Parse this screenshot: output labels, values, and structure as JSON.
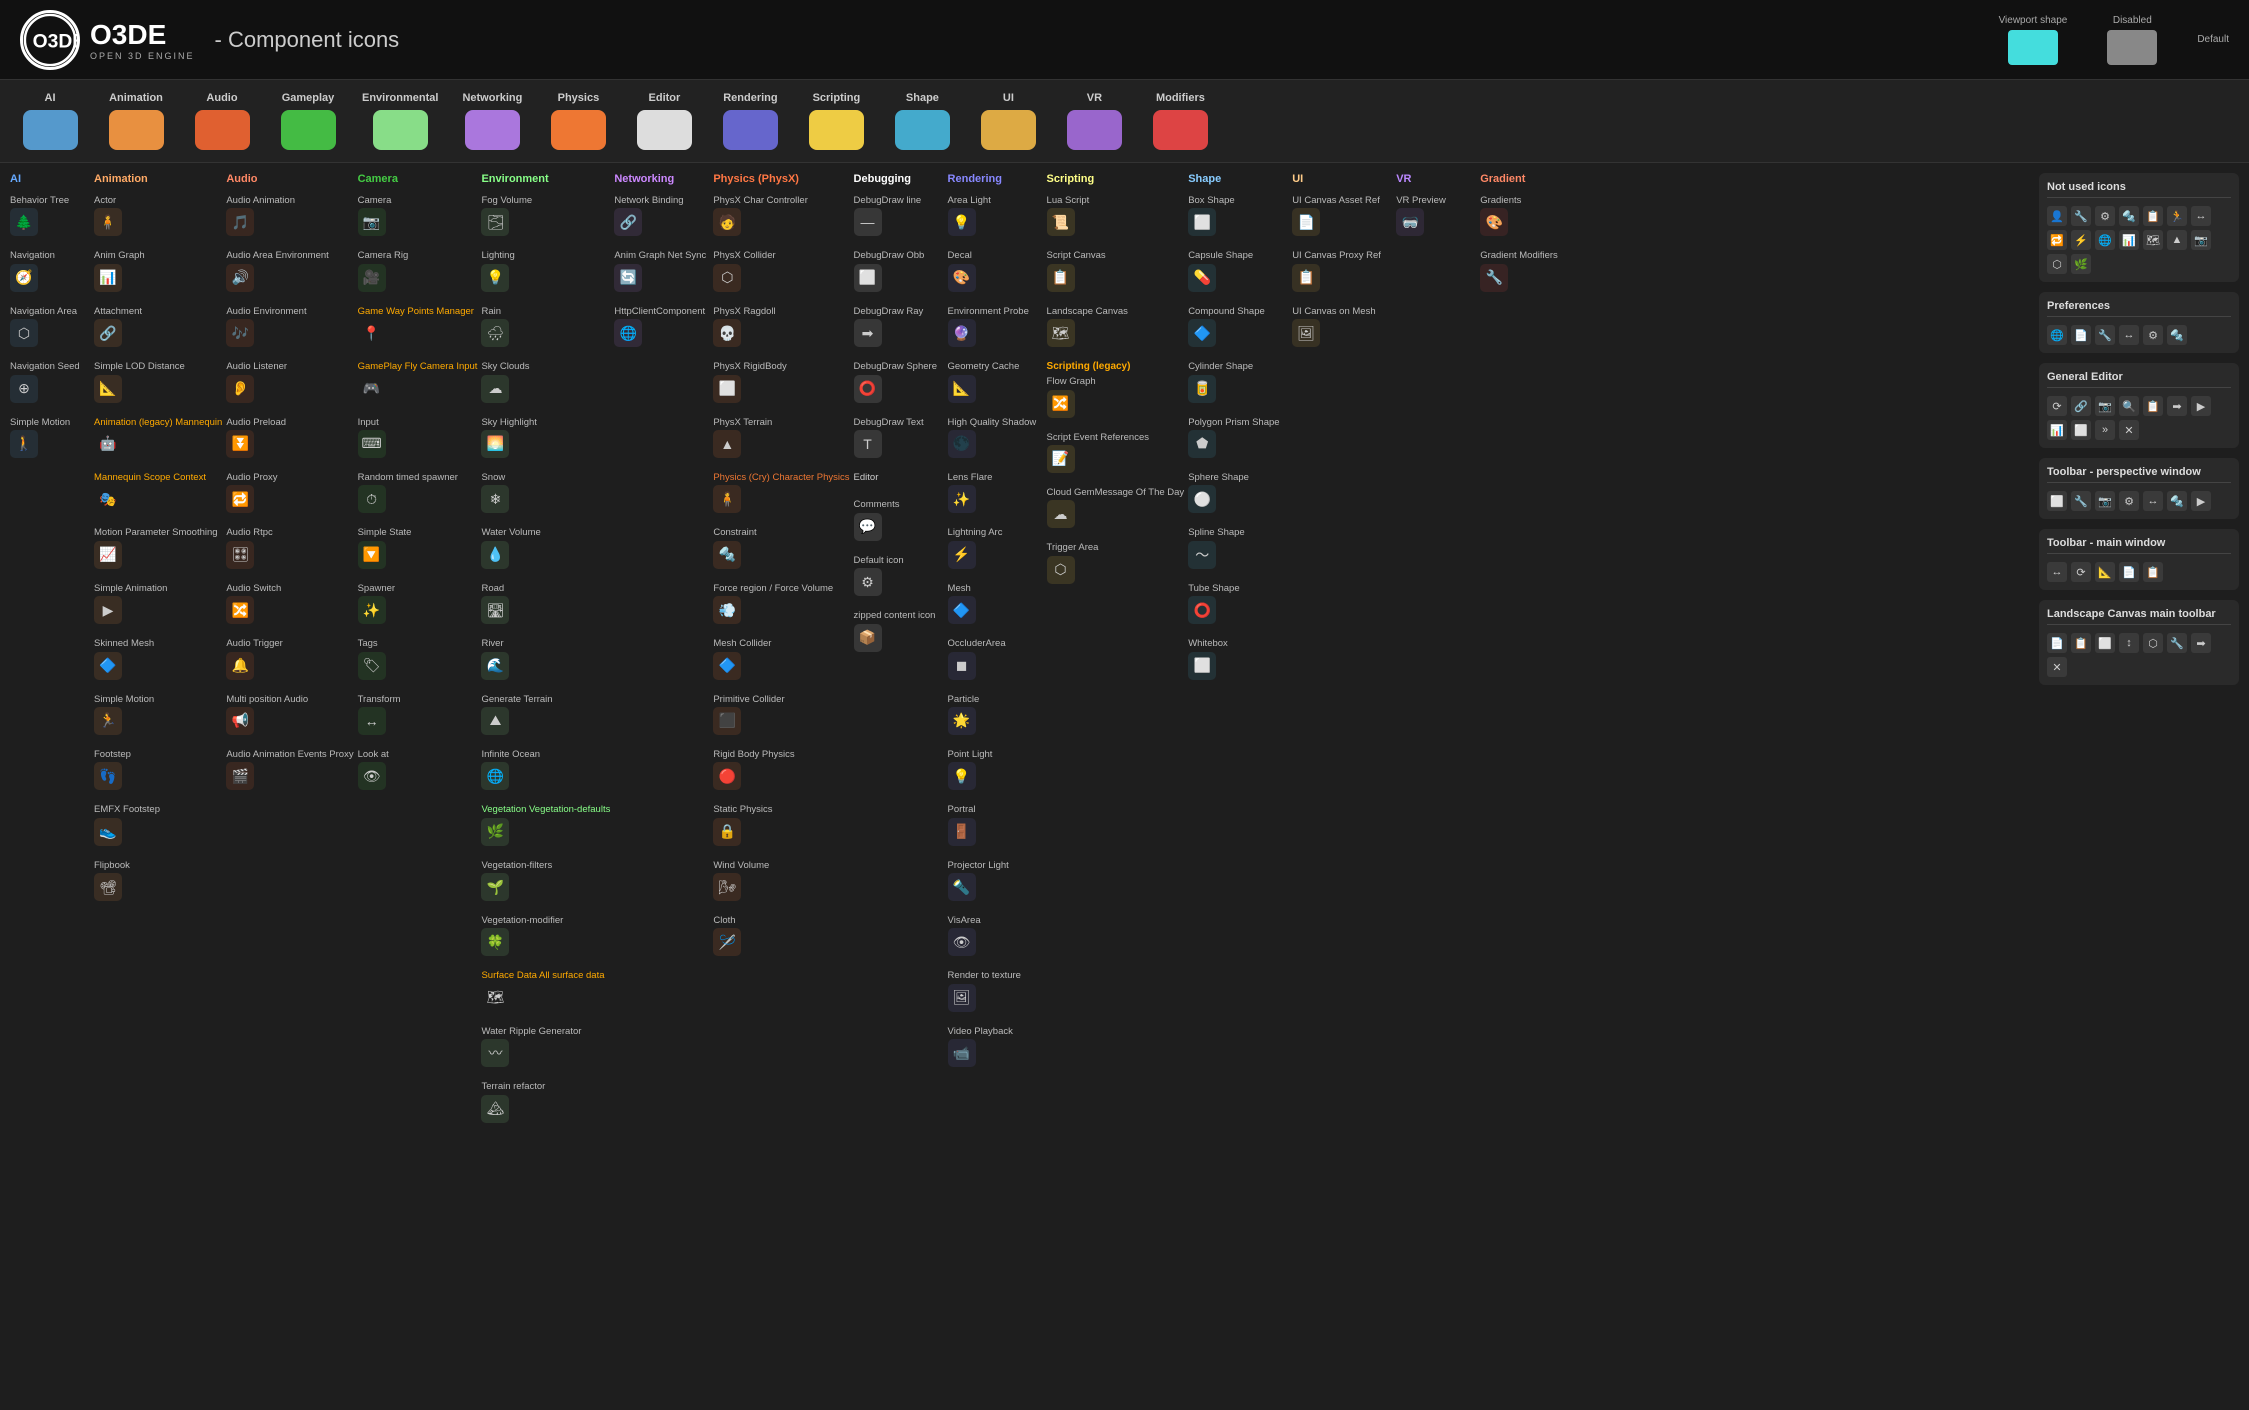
{
  "header": {
    "logo_text": "O3DE",
    "logo_sub": "OPEN 3D ENGINE",
    "title": "- Component icons",
    "viewport_shape_label": "Viewport shape",
    "disabled_label": "Disabled",
    "default_label": "Default"
  },
  "categories": [
    {
      "label": "AI",
      "color": "#5599cc"
    },
    {
      "label": "Animation",
      "color": "#e89040"
    },
    {
      "label": "Audio",
      "color": "#e06030"
    },
    {
      "label": "Gameplay",
      "color": "#44bb44"
    },
    {
      "label": "Environmental",
      "color": "#88dd88"
    },
    {
      "label": "Networking",
      "color": "#aa77dd"
    },
    {
      "label": "Physics",
      "color": "#ee7733"
    },
    {
      "label": "Editor",
      "color": "#dddddd"
    },
    {
      "label": "Rendering",
      "color": "#6666cc"
    },
    {
      "label": "Scripting",
      "color": "#eecc44"
    },
    {
      "label": "Shape",
      "color": "#44aacc"
    },
    {
      "label": "UI",
      "color": "#ddaa44"
    },
    {
      "label": "VR",
      "color": "#9966cc"
    },
    {
      "label": "Modifiers",
      "color": "#dd4444"
    }
  ],
  "columns": {
    "ai": {
      "header": "AI",
      "header_color": "#6af",
      "items": [
        {
          "name": "Behavior Tree",
          "icon": "🌲",
          "color": "#5599cc"
        },
        {
          "name": "Navigation",
          "icon": "🧭",
          "color": "#5599cc"
        },
        {
          "name": "Navigation Area",
          "icon": "⬡",
          "color": "#5599cc"
        },
        {
          "name": "Navigation Seed",
          "icon": "⊕",
          "color": "#5599cc"
        },
        {
          "name": "Simple Motion",
          "icon": "🚶",
          "color": "#5599cc"
        }
      ]
    },
    "animation": {
      "header": "Animation",
      "header_color": "#fa6",
      "items": [
        {
          "name": "Actor",
          "icon": "🧍",
          "color": "#e89040"
        },
        {
          "name": "Anim Graph",
          "icon": "📊",
          "color": "#e89040"
        },
        {
          "name": "Attachment",
          "icon": "🔗",
          "color": "#e89040"
        },
        {
          "name": "Simple LOD Distance",
          "icon": "📐",
          "color": "#e89040"
        },
        {
          "name": "Animation (legacy) Mannequin",
          "icon": "🤖",
          "color": "#fa0"
        },
        {
          "name": "Mannequin Scope Context",
          "icon": "🎭",
          "color": "#fa0"
        },
        {
          "name": "Motion Parameter Smoothing",
          "icon": "📈",
          "color": "#e89040"
        },
        {
          "name": "Simple Animation",
          "icon": "▶",
          "color": "#e89040"
        },
        {
          "name": "Skinned Mesh",
          "icon": "🔷",
          "color": "#e89040"
        },
        {
          "name": "Simple Motion",
          "icon": "🏃",
          "color": "#e89040"
        },
        {
          "name": "Footstep",
          "icon": "👣",
          "color": "#e89040"
        },
        {
          "name": "EMFX Footstep",
          "icon": "👟",
          "color": "#e89040"
        },
        {
          "name": "Flipbook",
          "icon": "📽",
          "color": "#e89040"
        }
      ]
    },
    "audio": {
      "header": "Audio",
      "header_color": "#f86",
      "items": [
        {
          "name": "Audio Animation",
          "icon": "🎵",
          "color": "#e06030"
        },
        {
          "name": "Audio Area Environment",
          "icon": "🔊",
          "color": "#e06030"
        },
        {
          "name": "Audio Environment",
          "icon": "🎶",
          "color": "#e06030"
        },
        {
          "name": "Audio Listener",
          "icon": "👂",
          "color": "#e06030"
        },
        {
          "name": "Audio Preload",
          "icon": "⏬",
          "color": "#e06030"
        },
        {
          "name": "Audio Proxy",
          "icon": "🔁",
          "color": "#e06030"
        },
        {
          "name": "Audio Rtpc",
          "icon": "🎛",
          "color": "#e06030"
        },
        {
          "name": "Audio Switch",
          "icon": "🔀",
          "color": "#e06030"
        },
        {
          "name": "Audio Trigger",
          "icon": "🔔",
          "color": "#e06030"
        },
        {
          "name": "Multi position Audio",
          "icon": "📢",
          "color": "#e06030"
        },
        {
          "name": "Audio Animation Events Proxy",
          "icon": "🎬",
          "color": "#e06030"
        }
      ]
    },
    "camera": {
      "header": "Camera",
      "header_color": "#4c4",
      "items": [
        {
          "name": "Camera",
          "icon": "📷",
          "color": "#44bb44"
        },
        {
          "name": "Camera Rig",
          "icon": "🎥",
          "color": "#44bb44"
        },
        {
          "name": "Game Way Points Manager",
          "icon": "📍",
          "color": "#fa0"
        },
        {
          "name": "GamePlay Fly Camera Input",
          "icon": "🎮",
          "color": "#fa0"
        },
        {
          "name": "Input",
          "icon": "⌨",
          "color": "#44bb44"
        },
        {
          "name": "Random timed spawner",
          "icon": "⏱",
          "color": "#44bb44"
        },
        {
          "name": "Simple State",
          "icon": "🔽",
          "color": "#44bb44"
        },
        {
          "name": "Spawner",
          "icon": "✨",
          "color": "#44bb44"
        },
        {
          "name": "Tags",
          "icon": "🏷",
          "color": "#44bb44"
        },
        {
          "name": "Transform",
          "icon": "↔",
          "color": "#44bb44"
        },
        {
          "name": "Look at",
          "icon": "👁",
          "color": "#44bb44"
        }
      ]
    },
    "environment": {
      "header": "Environment",
      "header_color": "#8f8",
      "items": [
        {
          "name": "Fog Volume",
          "icon": "🌫",
          "color": "#88dd88"
        },
        {
          "name": "Lighting",
          "icon": "💡",
          "color": "#88dd88"
        },
        {
          "name": "Rain",
          "icon": "🌧",
          "color": "#88dd88"
        },
        {
          "name": "Sky Clouds",
          "icon": "☁",
          "color": "#88dd88"
        },
        {
          "name": "Sky Highlight",
          "icon": "🌅",
          "color": "#88dd88"
        },
        {
          "name": "Snow",
          "icon": "❄",
          "color": "#88dd88"
        },
        {
          "name": "Water Volume",
          "icon": "💧",
          "color": "#88dd88"
        },
        {
          "name": "Road",
          "icon": "🛣",
          "color": "#88dd88"
        },
        {
          "name": "River",
          "icon": "🌊",
          "color": "#88dd88"
        },
        {
          "name": "Generate Terrain",
          "icon": "⛰",
          "color": "#88dd88"
        },
        {
          "name": "Infinite Ocean",
          "icon": "🌐",
          "color": "#88dd88"
        },
        {
          "name": "Vegetation Vegetation-defaults",
          "icon": "🌿",
          "color": "#88dd88"
        },
        {
          "name": "Vegetation-filters",
          "icon": "🌱",
          "color": "#88dd88"
        },
        {
          "name": "Vegetation-modifier",
          "icon": "🍀",
          "color": "#88dd88"
        },
        {
          "name": "Surface Data All surface data",
          "icon": "🗺",
          "color": "#fa0"
        },
        {
          "name": "Water Ripple Generator",
          "icon": "〰",
          "color": "#88dd88"
        },
        {
          "name": "Terrain refactor",
          "icon": "🏔",
          "color": "#88dd88"
        }
      ]
    },
    "networking": {
      "header": "Networking",
      "header_color": "#c8f",
      "items": [
        {
          "name": "Network Binding",
          "icon": "🔗",
          "color": "#aa77dd"
        },
        {
          "name": "Anim Graph Net Sync",
          "icon": "🔄",
          "color": "#aa77dd"
        },
        {
          "name": "HttpClientComponent",
          "icon": "🌐",
          "color": "#aa77dd"
        }
      ]
    },
    "physics": {
      "header": "Physics (PhysX)",
      "header_color": "#f74",
      "items": [
        {
          "name": "PhysX Char Controller",
          "icon": "🧑",
          "color": "#ee7733"
        },
        {
          "name": "PhysX Collider",
          "icon": "⬡",
          "color": "#ee7733"
        },
        {
          "name": "PhysX Ragdoll",
          "icon": "💀",
          "color": "#ee7733"
        },
        {
          "name": "PhysX RigidBody",
          "icon": "⬜",
          "color": "#ee7733"
        },
        {
          "name": "PhysX Terrain",
          "icon": "▲",
          "color": "#ee7733"
        },
        {
          "name": "Physics (Cry) Character Physics",
          "icon": "🧍",
          "color": "#ee7733"
        },
        {
          "name": "Constraint",
          "icon": "🔩",
          "color": "#ee7733"
        },
        {
          "name": "Force region / Force Volume",
          "icon": "💨",
          "color": "#ee7733"
        },
        {
          "name": "Mesh Collider",
          "icon": "🔷",
          "color": "#ee7733"
        },
        {
          "name": "Primitive Collider",
          "icon": "⬛",
          "color": "#ee7733"
        },
        {
          "name": "Rigid Body Physics",
          "icon": "🔴",
          "color": "#ee7733"
        },
        {
          "name": "Static Physics",
          "icon": "🔒",
          "color": "#ee7733"
        },
        {
          "name": "Wind Volume",
          "icon": "🌬",
          "color": "#ee7733"
        },
        {
          "name": "Cloth",
          "icon": "🪡",
          "color": "#ee7733"
        }
      ]
    },
    "debugging": {
      "header": "Debugging",
      "header_color": "#fff",
      "items": [
        {
          "name": "DebugDraw line",
          "icon": "—",
          "color": "#ddd"
        },
        {
          "name": "DebugDraw Obb",
          "icon": "⬜",
          "color": "#ddd"
        },
        {
          "name": "DebugDraw Ray",
          "icon": "➡",
          "color": "#ddd"
        },
        {
          "name": "DebugDraw Sphere",
          "icon": "⭕",
          "color": "#ddd"
        },
        {
          "name": "DebugDraw Text",
          "icon": "T",
          "color": "#ddd"
        },
        {
          "name": "Editor Comments",
          "icon": "💬",
          "color": "#ddd"
        },
        {
          "name": "Default icon",
          "icon": "⚙",
          "color": "#ddd"
        },
        {
          "name": "zipped content icon",
          "icon": "📦",
          "color": "#ddd"
        }
      ]
    },
    "rendering": {
      "header": "Rendering",
      "header_color": "#88f",
      "items": [
        {
          "name": "Area Light",
          "icon": "💡",
          "color": "#6666cc"
        },
        {
          "name": "Decal",
          "icon": "🎨",
          "color": "#6666cc"
        },
        {
          "name": "Environment Probe",
          "icon": "🔮",
          "color": "#6666cc"
        },
        {
          "name": "Geometry Cache",
          "icon": "📐",
          "color": "#6666cc"
        },
        {
          "name": "High Quality Shadow",
          "icon": "🌑",
          "color": "#6666cc"
        },
        {
          "name": "Lens Flare",
          "icon": "✨",
          "color": "#6666cc"
        },
        {
          "name": "Lightning Arc",
          "icon": "⚡",
          "color": "#6666cc"
        },
        {
          "name": "Mesh",
          "icon": "🔷",
          "color": "#6666cc"
        },
        {
          "name": "OccluderArea",
          "icon": "◼",
          "color": "#6666cc"
        },
        {
          "name": "Particle",
          "icon": "🌟",
          "color": "#6666cc"
        },
        {
          "name": "Point Light",
          "icon": "💡",
          "color": "#6666cc"
        },
        {
          "name": "Portral",
          "icon": "🚪",
          "color": "#6666cc"
        },
        {
          "name": "Projector Light",
          "icon": "🔦",
          "color": "#6666cc"
        },
        {
          "name": "VisArea",
          "icon": "👁",
          "color": "#6666cc"
        },
        {
          "name": "Render to texture",
          "icon": "🖼",
          "color": "#6666cc"
        },
        {
          "name": "Video Playback",
          "icon": "📹",
          "color": "#6666cc"
        }
      ]
    },
    "scripting": {
      "header": "Scripting",
      "header_color": "#ff8",
      "items": [
        {
          "name": "Lua Script",
          "icon": "📜",
          "color": "#eecc44"
        },
        {
          "name": "Script Canvas",
          "icon": "📋",
          "color": "#eecc44"
        },
        {
          "name": "Landscape Canvas",
          "icon": "🗺",
          "color": "#eecc44"
        },
        {
          "name": "Flow Graph",
          "icon": "🔀",
          "color": "#eecc44"
        },
        {
          "name": "Script Event References",
          "icon": "📝",
          "color": "#eecc44"
        },
        {
          "name": "Cloud GemMessage Of The Day",
          "icon": "☁",
          "color": "#eecc44"
        },
        {
          "name": "Trigger Area",
          "icon": "⬡",
          "color": "#eecc44"
        }
      ]
    },
    "shape": {
      "header": "Shape",
      "header_color": "#8cf",
      "items": [
        {
          "name": "Box Shape",
          "icon": "⬜",
          "color": "#44aacc"
        },
        {
          "name": "Capsule Shape",
          "icon": "💊",
          "color": "#44aacc"
        },
        {
          "name": "Compound Shape",
          "icon": "🔷",
          "color": "#44aacc"
        },
        {
          "name": "Cylinder Shape",
          "icon": "🥫",
          "color": "#44aacc"
        },
        {
          "name": "Polygon Prism Shape",
          "icon": "⬟",
          "color": "#44aacc"
        },
        {
          "name": "Sphere Shape",
          "icon": "⚪",
          "color": "#44aacc"
        },
        {
          "name": "Spline Shape",
          "icon": "〜",
          "color": "#44aacc"
        },
        {
          "name": "Tube Shape",
          "icon": "⭕",
          "color": "#44aacc"
        },
        {
          "name": "Whitebox",
          "icon": "⬜",
          "color": "#44aacc"
        }
      ]
    },
    "ui": {
      "header": "UI",
      "header_color": "#fc8",
      "items": [
        {
          "name": "UI Canvas Asset Ref",
          "icon": "📄",
          "color": "#ddaa44"
        },
        {
          "name": "UI Canvas Proxy Ref",
          "icon": "📋",
          "color": "#ddaa44"
        },
        {
          "name": "UI Canvas on Mesh",
          "icon": "🖼",
          "color": "#ddaa44"
        }
      ]
    },
    "vr": {
      "header": "VR",
      "header_color": "#b8f",
      "items": [
        {
          "name": "VR Preview",
          "icon": "🥽",
          "color": "#9966cc"
        }
      ]
    },
    "gradient": {
      "header": "Gradient",
      "header_color": "#f86",
      "items": [
        {
          "name": "Gradients",
          "icon": "🎨",
          "color": "#dd4444"
        },
        {
          "name": "Gradient Modifiers",
          "icon": "🔧",
          "color": "#dd4444"
        }
      ]
    }
  },
  "right_panel": {
    "not_used_title": "Not used icons",
    "preferences_title": "Preferences",
    "general_editor_title": "General Editor",
    "toolbar_perspective_title": "Toolbar - perspective window",
    "toolbar_main_title": "Toolbar - main window",
    "landscape_canvas_title": "Landscape Canvas main toolbar"
  }
}
